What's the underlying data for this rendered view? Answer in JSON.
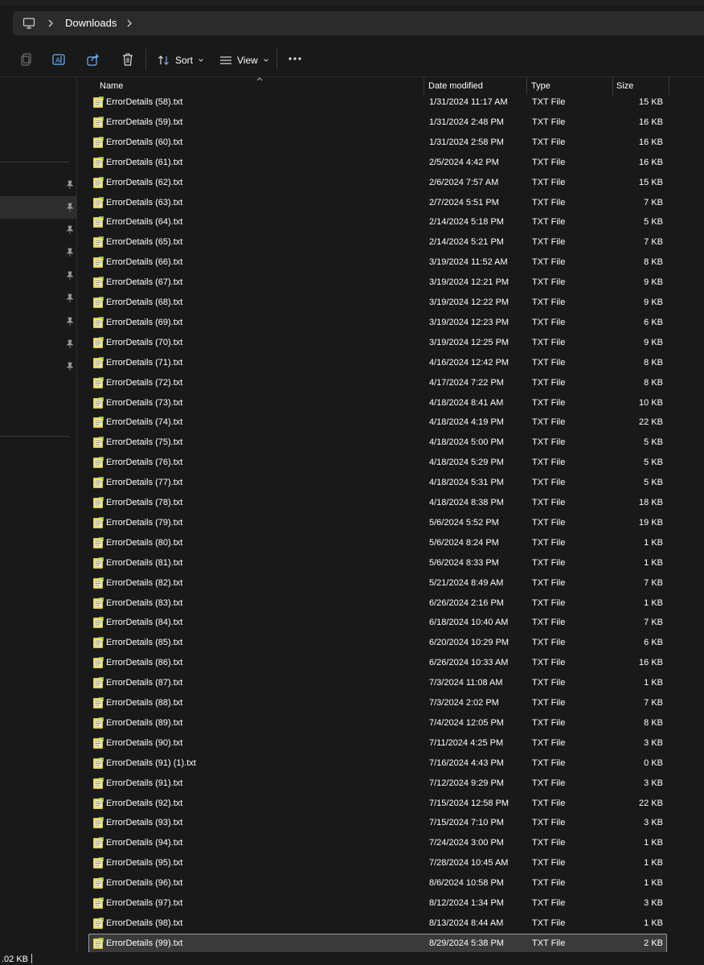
{
  "address": {
    "location": "Downloads"
  },
  "toolbar": {
    "sort_label": "Sort",
    "view_label": "View"
  },
  "columns": {
    "name": "Name",
    "date": "Date modified",
    "type": "Type",
    "size": "Size"
  },
  "files": [
    {
      "name": "ErrorDetails (58).txt",
      "date": "1/31/2024 11:17 AM",
      "type": "TXT File",
      "size": "15 KB"
    },
    {
      "name": "ErrorDetails (59).txt",
      "date": "1/31/2024 2:48 PM",
      "type": "TXT File",
      "size": "16 KB"
    },
    {
      "name": "ErrorDetails (60).txt",
      "date": "1/31/2024 2:58 PM",
      "type": "TXT File",
      "size": "16 KB"
    },
    {
      "name": "ErrorDetails (61).txt",
      "date": "2/5/2024 4:42 PM",
      "type": "TXT File",
      "size": "16 KB"
    },
    {
      "name": "ErrorDetails (62).txt",
      "date": "2/6/2024 7:57 AM",
      "type": "TXT File",
      "size": "15 KB"
    },
    {
      "name": "ErrorDetails (63).txt",
      "date": "2/7/2024 5:51 PM",
      "type": "TXT File",
      "size": "7 KB"
    },
    {
      "name": "ErrorDetails (64).txt",
      "date": "2/14/2024 5:18 PM",
      "type": "TXT File",
      "size": "5 KB"
    },
    {
      "name": "ErrorDetails (65).txt",
      "date": "2/14/2024 5:21 PM",
      "type": "TXT File",
      "size": "7 KB"
    },
    {
      "name": "ErrorDetails (66).txt",
      "date": "3/19/2024 11:52 AM",
      "type": "TXT File",
      "size": "8 KB"
    },
    {
      "name": "ErrorDetails (67).txt",
      "date": "3/19/2024 12:21 PM",
      "type": "TXT File",
      "size": "9 KB"
    },
    {
      "name": "ErrorDetails (68).txt",
      "date": "3/19/2024 12:22 PM",
      "type": "TXT File",
      "size": "9 KB"
    },
    {
      "name": "ErrorDetails (69).txt",
      "date": "3/19/2024 12:23 PM",
      "type": "TXT File",
      "size": "6 KB"
    },
    {
      "name": "ErrorDetails (70).txt",
      "date": "3/19/2024 12:25 PM",
      "type": "TXT File",
      "size": "9 KB"
    },
    {
      "name": "ErrorDetails (71).txt",
      "date": "4/16/2024 12:42 PM",
      "type": "TXT File",
      "size": "8 KB"
    },
    {
      "name": "ErrorDetails (72).txt",
      "date": "4/17/2024 7:22 PM",
      "type": "TXT File",
      "size": "8 KB"
    },
    {
      "name": "ErrorDetails (73).txt",
      "date": "4/18/2024 8:41 AM",
      "type": "TXT File",
      "size": "10 KB"
    },
    {
      "name": "ErrorDetails (74).txt",
      "date": "4/18/2024 4:19 PM",
      "type": "TXT File",
      "size": "22 KB"
    },
    {
      "name": "ErrorDetails (75).txt",
      "date": "4/18/2024 5:00 PM",
      "type": "TXT File",
      "size": "5 KB"
    },
    {
      "name": "ErrorDetails (76).txt",
      "date": "4/18/2024 5:29 PM",
      "type": "TXT File",
      "size": "5 KB"
    },
    {
      "name": "ErrorDetails (77).txt",
      "date": "4/18/2024 5:31 PM",
      "type": "TXT File",
      "size": "5 KB"
    },
    {
      "name": "ErrorDetails (78).txt",
      "date": "4/18/2024 8:38 PM",
      "type": "TXT File",
      "size": "18 KB"
    },
    {
      "name": "ErrorDetails (79).txt",
      "date": "5/6/2024 5:52 PM",
      "type": "TXT File",
      "size": "19 KB"
    },
    {
      "name": "ErrorDetails (80).txt",
      "date": "5/6/2024 8:24 PM",
      "type": "TXT File",
      "size": "1 KB"
    },
    {
      "name": "ErrorDetails (81).txt",
      "date": "5/6/2024 8:33 PM",
      "type": "TXT File",
      "size": "1 KB"
    },
    {
      "name": "ErrorDetails (82).txt",
      "date": "5/21/2024 8:49 AM",
      "type": "TXT File",
      "size": "7 KB"
    },
    {
      "name": "ErrorDetails (83).txt",
      "date": "6/26/2024 2:16 PM",
      "type": "TXT File",
      "size": "1 KB"
    },
    {
      "name": "ErrorDetails (84).txt",
      "date": "6/18/2024 10:40 AM",
      "type": "TXT File",
      "size": "7 KB"
    },
    {
      "name": "ErrorDetails (85).txt",
      "date": "6/20/2024 10:29 PM",
      "type": "TXT File",
      "size": "6 KB"
    },
    {
      "name": "ErrorDetails (86).txt",
      "date": "6/26/2024 10:33 AM",
      "type": "TXT File",
      "size": "16 KB"
    },
    {
      "name": "ErrorDetails (87).txt",
      "date": "7/3/2024 11:08 AM",
      "type": "TXT File",
      "size": "1 KB"
    },
    {
      "name": "ErrorDetails (88).txt",
      "date": "7/3/2024 2:02 PM",
      "type": "TXT File",
      "size": "7 KB"
    },
    {
      "name": "ErrorDetails (89).txt",
      "date": "7/4/2024 12:05 PM",
      "type": "TXT File",
      "size": "8 KB"
    },
    {
      "name": "ErrorDetails (90).txt",
      "date": "7/11/2024 4:25 PM",
      "type": "TXT File",
      "size": "3 KB"
    },
    {
      "name": "ErrorDetails (91) (1).txt",
      "date": "7/16/2024 4:43 PM",
      "type": "TXT File",
      "size": "0 KB"
    },
    {
      "name": "ErrorDetails (91).txt",
      "date": "7/12/2024 9:29 PM",
      "type": "TXT File",
      "size": "3 KB"
    },
    {
      "name": "ErrorDetails (92).txt",
      "date": "7/15/2024 12:58 PM",
      "type": "TXT File",
      "size": "22 KB"
    },
    {
      "name": "ErrorDetails (93).txt",
      "date": "7/15/2024 7:10 PM",
      "type": "TXT File",
      "size": "3 KB"
    },
    {
      "name": "ErrorDetails (94).txt",
      "date": "7/24/2024 3:00 PM",
      "type": "TXT File",
      "size": "1 KB"
    },
    {
      "name": "ErrorDetails (95).txt",
      "date": "7/28/2024 10:45 AM",
      "type": "TXT File",
      "size": "1 KB"
    },
    {
      "name": "ErrorDetails (96).txt",
      "date": "8/6/2024 10:58 PM",
      "type": "TXT File",
      "size": "1 KB"
    },
    {
      "name": "ErrorDetails (97).txt",
      "date": "8/12/2024 1:34 PM",
      "type": "TXT File",
      "size": "3 KB"
    },
    {
      "name": "ErrorDetails (98).txt",
      "date": "8/13/2024 8:44 AM",
      "type": "TXT File",
      "size": "1 KB"
    },
    {
      "name": "ErrorDetails (99).txt",
      "date": "8/29/2024 5:38 PM",
      "type": "TXT File",
      "size": "2 KB",
      "selected": true
    }
  ],
  "status": {
    "selection_size": ".02 KB"
  },
  "colors": {
    "background": "#191919",
    "address_bg": "#2b2b2b",
    "selection_bg": "#3a3a3a",
    "selection_border": "#9a9a9a",
    "file_icon": "#e6cf4a"
  },
  "icons": [
    "computer-icon",
    "chevron-right-icon",
    "copy-icon",
    "rename-icon",
    "share-icon",
    "delete-icon",
    "sort-icon",
    "view-icon",
    "more-icon",
    "pin-icon",
    "text-file-icon"
  ]
}
